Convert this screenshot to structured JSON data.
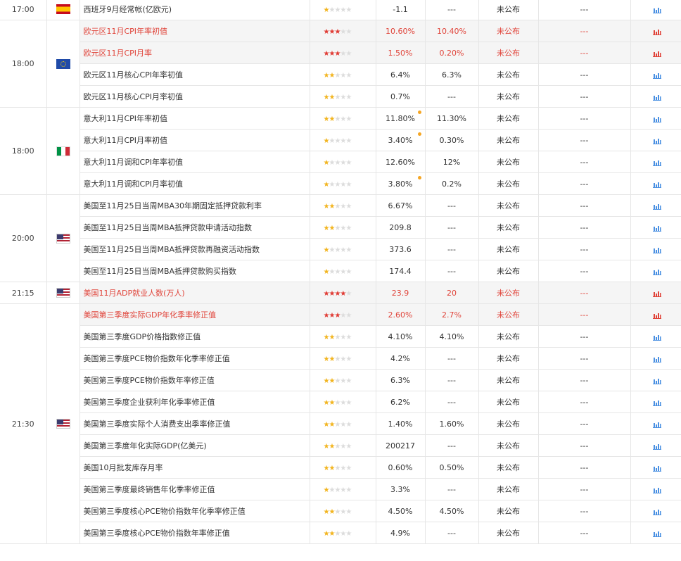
{
  "colors": {
    "star_on": "#f2b41e",
    "star_on_highlight": "#e03a33",
    "highlight_text": "#e0443a",
    "chart_icon": "#4a90e2",
    "chart_icon_highlight": "#e0443a"
  },
  "groups": [
    {
      "time": "17:00",
      "flag": "es",
      "rows": [
        {
          "name": "西班牙9月经常帐(亿欧元)",
          "stars": 1,
          "actual": "-1.1",
          "forecast": "---",
          "published": "未公布",
          "impact": "---",
          "hl": false,
          "dot": false
        }
      ]
    },
    {
      "time": "18:00",
      "flag": "eu",
      "rows": [
        {
          "name": "欧元区11月CPI年率初值",
          "stars": 3,
          "actual": "10.60%",
          "forecast": "10.40%",
          "published": "未公布",
          "impact": "---",
          "hl": true,
          "dot": false
        },
        {
          "name": "欧元区11月CPI月率",
          "stars": 3,
          "actual": "1.50%",
          "forecast": "0.20%",
          "published": "未公布",
          "impact": "---",
          "hl": true,
          "dot": false
        },
        {
          "name": "欧元区11月核心CPI年率初值",
          "stars": 2,
          "actual": "6.4%",
          "forecast": "6.3%",
          "published": "未公布",
          "impact": "---",
          "hl": false,
          "dot": false
        },
        {
          "name": "欧元区11月核心CPI月率初值",
          "stars": 2,
          "actual": "0.7%",
          "forecast": "---",
          "published": "未公布",
          "impact": "---",
          "hl": false,
          "dot": false
        }
      ]
    },
    {
      "time": "18:00",
      "flag": "it",
      "rows": [
        {
          "name": "意大利11月CPI年率初值",
          "stars": 2,
          "actual": "11.80%",
          "forecast": "11.30%",
          "published": "未公布",
          "impact": "---",
          "hl": false,
          "dot": true
        },
        {
          "name": "意大利11月CPI月率初值",
          "stars": 1,
          "actual": "3.40%",
          "forecast": "0.30%",
          "published": "未公布",
          "impact": "---",
          "hl": false,
          "dot": true
        },
        {
          "name": "意大利11月调和CPI年率初值",
          "stars": 1,
          "actual": "12.60%",
          "forecast": "12%",
          "published": "未公布",
          "impact": "---",
          "hl": false,
          "dot": false
        },
        {
          "name": "意大利11月调和CPI月率初值",
          "stars": 1,
          "actual": "3.80%",
          "forecast": "0.2%",
          "published": "未公布",
          "impact": "---",
          "hl": false,
          "dot": true
        }
      ]
    },
    {
      "time": "20:00",
      "flag": "us",
      "rows": [
        {
          "name": "美国至11月25日当周MBA30年期固定抵押贷款利率",
          "stars": 2,
          "actual": "6.67%",
          "forecast": "---",
          "published": "未公布",
          "impact": "---",
          "hl": false,
          "dot": false
        },
        {
          "name": "美国至11月25日当周MBA抵押贷款申请活动指数",
          "stars": 2,
          "actual": "209.8",
          "forecast": "---",
          "published": "未公布",
          "impact": "---",
          "hl": false,
          "dot": false
        },
        {
          "name": "美国至11月25日当周MBA抵押贷款再融资活动指数",
          "stars": 1,
          "actual": "373.6",
          "forecast": "---",
          "published": "未公布",
          "impact": "---",
          "hl": false,
          "dot": false
        },
        {
          "name": "美国至11月25日当周MBA抵押贷款购买指数",
          "stars": 1,
          "actual": "174.4",
          "forecast": "---",
          "published": "未公布",
          "impact": "---",
          "hl": false,
          "dot": false
        }
      ]
    },
    {
      "time": "21:15",
      "flag": "us",
      "rows": [
        {
          "name": "美国11月ADP就业人数(万人)",
          "stars": 4,
          "actual": "23.9",
          "forecast": "20",
          "published": "未公布",
          "impact": "---",
          "hl": true,
          "dot": false
        }
      ]
    },
    {
      "time": "21:30",
      "flag": "us",
      "rows": [
        {
          "name": "美国第三季度实际GDP年化季率修正值",
          "stars": 3,
          "actual": "2.60%",
          "forecast": "2.7%",
          "published": "未公布",
          "impact": "---",
          "hl": true,
          "dot": false
        },
        {
          "name": "美国第三季度GDP价格指数修正值",
          "stars": 2,
          "actual": "4.10%",
          "forecast": "4.10%",
          "published": "未公布",
          "impact": "---",
          "hl": false,
          "dot": false
        },
        {
          "name": "美国第三季度PCE物价指数年化季率修正值",
          "stars": 2,
          "actual": "4.2%",
          "forecast": "---",
          "published": "未公布",
          "impact": "---",
          "hl": false,
          "dot": false
        },
        {
          "name": "美国第三季度PCE物价指数年率修正值",
          "stars": 2,
          "actual": "6.3%",
          "forecast": "---",
          "published": "未公布",
          "impact": "---",
          "hl": false,
          "dot": false
        },
        {
          "name": "美国第三季度企业获利年化季率修正值",
          "stars": 2,
          "actual": "6.2%",
          "forecast": "---",
          "published": "未公布",
          "impact": "---",
          "hl": false,
          "dot": false
        },
        {
          "name": "美国第三季度实际个人消费支出季率修正值",
          "stars": 2,
          "actual": "1.40%",
          "forecast": "1.60%",
          "published": "未公布",
          "impact": "---",
          "hl": false,
          "dot": false
        },
        {
          "name": "美国第三季度年化实际GDP(亿美元)",
          "stars": 2,
          "actual": "200217",
          "forecast": "---",
          "published": "未公布",
          "impact": "---",
          "hl": false,
          "dot": false
        },
        {
          "name": "美国10月批发库存月率",
          "stars": 2,
          "actual": "0.60%",
          "forecast": "0.50%",
          "published": "未公布",
          "impact": "---",
          "hl": false,
          "dot": false
        },
        {
          "name": "美国第三季度最终销售年化季率修正值",
          "stars": 1,
          "actual": "3.3%",
          "forecast": "---",
          "published": "未公布",
          "impact": "---",
          "hl": false,
          "dot": false
        },
        {
          "name": "美国第三季度核心PCE物价指数年化季率修正值",
          "stars": 2,
          "actual": "4.50%",
          "forecast": "4.50%",
          "published": "未公布",
          "impact": "---",
          "hl": false,
          "dot": false
        },
        {
          "name": "美国第三季度核心PCE物价指数年率修正值",
          "stars": 2,
          "actual": "4.9%",
          "forecast": "---",
          "published": "未公布",
          "impact": "---",
          "hl": false,
          "dot": false
        }
      ]
    }
  ]
}
